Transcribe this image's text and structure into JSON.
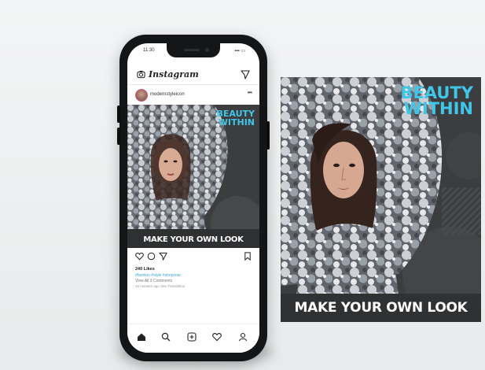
{
  "statusbar": {
    "time": "11:30",
    "signal": "▪▪▪ ▭"
  },
  "app": {
    "logo": "Instagram"
  },
  "post": {
    "username": "modernstyleicon",
    "more": "•••",
    "likes": "240 Likes",
    "caption": "#fashion #style #shopnow",
    "comments": "View All 3 Comments",
    "meta": "15 minutes ago   See Translation"
  },
  "creative": {
    "title_line1": "BEAUTY",
    "title_line2": "WITHIN",
    "tagline": "MAKE YOUR OWN LOOK"
  },
  "colors": {
    "accent": "#3fc6e8",
    "dark": "#3c3d3f",
    "band": "#303133"
  },
  "icons": [
    "camera-icon",
    "direct-message-icon",
    "heart-icon",
    "comment-icon",
    "share-icon",
    "bookmark-icon",
    "home-icon",
    "search-icon",
    "add-post-icon",
    "activity-icon",
    "profile-icon"
  ]
}
